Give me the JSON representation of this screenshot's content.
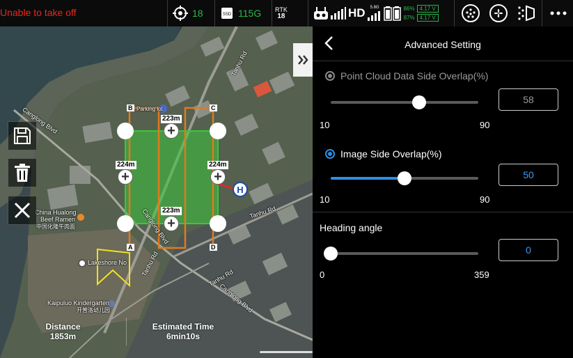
{
  "topbar": {
    "warning": "Unable to take off",
    "gps_count": "18",
    "storage_label": "SSD",
    "storage_value": "115G",
    "rtk_label": "RTK",
    "rtk_count": "18",
    "link_label": "HD",
    "link_band": "5.8G",
    "battery1_percent": "86%",
    "battery1_voltage": "4.17 V",
    "battery2_percent": "87%",
    "battery2_voltage": "4.17 V"
  },
  "map": {
    "collapse_icon": "double-chevron-right-icon",
    "side_buttons": [
      "save-icon",
      "trash-icon",
      "close-icon"
    ],
    "corner_labels": [
      "B",
      "C",
      "A",
      "D"
    ],
    "distance_labels": {
      "top": "223m",
      "bottom": "223m",
      "left": "224m",
      "right": "224m"
    },
    "home_marker": "H",
    "places": {
      "china_hualong_line1": "China Hualong",
      "china_hualong_line2": "Beef Ramen",
      "china_hualong_cn": "中国化隆牛肉面",
      "lakeshore": "Lakeshore No",
      "kindergarten": "Kaipuluo Kindergarten",
      "kindergarten_cn": "开普洛幼儿园",
      "parking": "Parking lot",
      "tanhu_rd": "Tanhu Rd",
      "canglong_blvd": "Canglong Blvd"
    },
    "distance_title": "Distance",
    "distance_value": "1853m",
    "time_title": "Estimated Time",
    "time_value": "6min10s"
  },
  "panel": {
    "title": "Advanced Setting",
    "point_cloud": {
      "label": "Point Cloud Data Side Overlap(%)",
      "value": "58",
      "min": "10",
      "max": "90",
      "selected": false,
      "fraction": 0.6
    },
    "image_side": {
      "label": "Image Side Overlap(%)",
      "value": "50",
      "min": "10",
      "max": "90",
      "selected": true,
      "fraction": 0.5
    },
    "heading": {
      "label": "Heading angle",
      "value": "0",
      "min": "0",
      "max": "359",
      "fraction": 0.0
    }
  },
  "colors": {
    "warning": "#e8271f",
    "accent": "#2b8fe9",
    "status_green": "#2db84b",
    "route_orange": "#e07b1f",
    "area_green": "#3cc63c"
  }
}
